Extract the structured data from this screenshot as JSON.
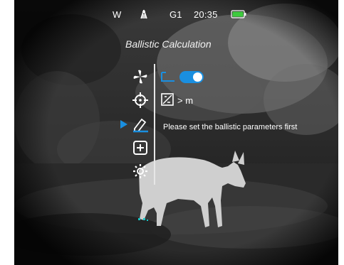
{
  "status_bar": {
    "mode": "W",
    "profile": "G1",
    "time": "20:35",
    "battery_color": "#3ecb3e",
    "icons": [
      "wifi-tower-icon",
      "battery-icon"
    ]
  },
  "screen_title": "Ballistic Calculation",
  "menu": {
    "items": [
      {
        "name": "palette-icon"
      },
      {
        "name": "crosshair-target-icon"
      },
      {
        "name": "ballistic-profile-icon",
        "selected": true
      },
      {
        "name": "add-icon"
      },
      {
        "name": "settings-gear-icon"
      }
    ],
    "accent_color": "#1a8fe0"
  },
  "ballistic_panel": {
    "toggle_on": true,
    "range_unit_label": "> m",
    "warning_message": "Please set the ballistic parameters first"
  }
}
